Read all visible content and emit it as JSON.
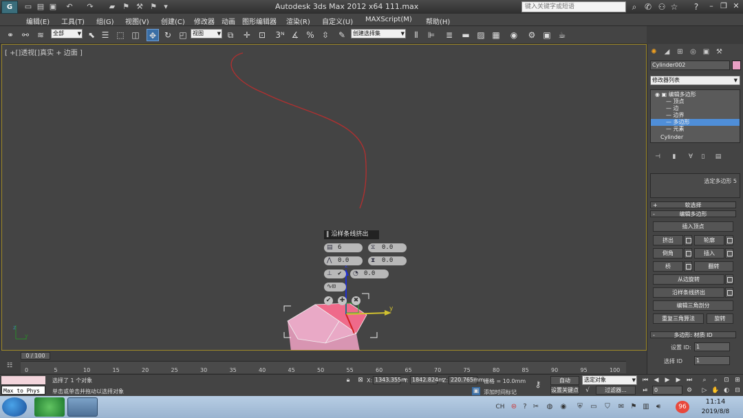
{
  "titlebar": {
    "title": "Autodesk 3ds Max  2012 x64     111.max",
    "search_placeholder": "键入关键字或短语",
    "app_logo": "3ds-max-logo"
  },
  "menubar": [
    "编辑(E)",
    "工具(T)",
    "组(G)",
    "视图(V)",
    "创建(C)",
    "修改器",
    "动画",
    "图形编辑器",
    "渲染(R)",
    "自定义(U)",
    "MAXScript(M)",
    "帮助(H)"
  ],
  "toolbar": {
    "filter": "全部",
    "ref_coord": "视图",
    "named_selection": "创建选择集"
  },
  "viewport": {
    "label": "[ +[]透视[]真实 + 边面 ]"
  },
  "caddy": {
    "title": "‖ 沿样条线挤出",
    "segments": "6",
    "taper_amount": "0.0",
    "taper_curve": "0.0",
    "twist": "0.0",
    "rotation": "0.0",
    "align_check": "✔"
  },
  "command_panel": {
    "object_name": "Cylinder002",
    "object_color": "#e89fc4",
    "modifier_list": "修改器列表",
    "stack": [
      {
        "label": "编辑多边形",
        "indent": 0
      },
      {
        "label": "顶点",
        "indent": 1
      },
      {
        "label": "边",
        "indent": 1
      },
      {
        "label": "边界",
        "indent": 1
      },
      {
        "label": "多边形",
        "indent": 1
      },
      {
        "label": "元素",
        "indent": 1
      },
      {
        "label": "Cylinder",
        "indent": 0
      }
    ],
    "selected_info": "选定多边形 5",
    "rollout_soft": "软选择",
    "rollout_edit": "编辑多边形",
    "insert_vertex": "插入顶点",
    "extrude": "挤出",
    "outline": "轮廓",
    "bevel": "倒角",
    "inset": "插入",
    "bridge": "桥",
    "flip": "翻转",
    "hinge": "从边旋转",
    "extrude_spline": "沿样条线挤出",
    "edit_tri": "编辑三角剖分",
    "retriangulate": "重复三角算法",
    "turn": "旋转",
    "rollout_mat": "多边形: 材质 ID",
    "set_id_label": "设置 ID:",
    "set_id_value": "1",
    "select_id_label": "选择 ID",
    "select_id_value": "1"
  },
  "timeline": {
    "slider": "0 / 100",
    "ticks": [
      "0",
      "5",
      "10",
      "15",
      "20",
      "25",
      "30",
      "35",
      "40",
      "45",
      "50",
      "55",
      "60",
      "65",
      "70",
      "75",
      "80",
      "85",
      "90",
      "95",
      "100"
    ]
  },
  "status": {
    "maxscript_out": "Max to Phys",
    "selected": "选择了 1 个对象",
    "prompt": "单击或单击并拖动以选择对象",
    "x_label": "X:",
    "x": "1343.355m",
    "y_label": "Y:",
    "y": "1842.824m",
    "z_label": "Z:",
    "z": "220.765mm",
    "grid": "栅格 = 10.0mm",
    "auto_key": "自动",
    "set_key": "设置关键点",
    "selected_dd": "选定对象",
    "filter": "过滤器...",
    "add_time_tag": "添加时间标记",
    "frame": "0"
  },
  "taskbar": {
    "lang": "CH",
    "badge": "96",
    "time": "11:14",
    "date": "2019/8/8"
  }
}
